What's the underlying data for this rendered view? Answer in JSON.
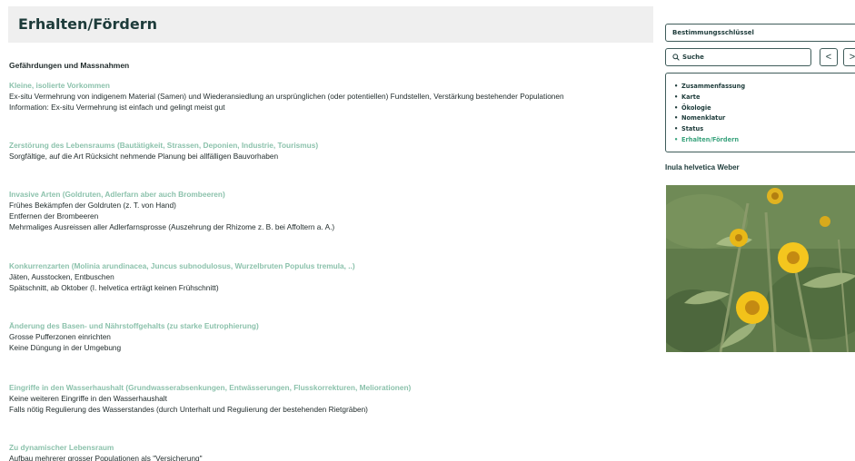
{
  "header": {
    "title": "Erhalten/Fördern"
  },
  "section_title": "Gefährdungen und Massnahmen",
  "sections": [
    {
      "threat": "Kleine, isolierte Vorkommen",
      "measures": [
        "Ex-situ Vermehrung von indigenem Material (Samen) und Wiederansiedlung an ursprünglichen (oder potentiellen) Fundstellen, Verstärkung bestehender Populationen",
        "Information: Ex-situ Vermehrung ist einfach und gelingt meist gut"
      ]
    },
    {
      "threat": "Zerstörung des Lebensraums (Bautätigkeit, Strassen, Deponien, Industrie, Tourismus)",
      "measures": [
        "Sorgfältige, auf die Art Rücksicht nehmende Planung bei allfälligen Bauvorhaben"
      ]
    },
    {
      "threat": "Invasive Arten (Goldruten, Adlerfarn aber auch Brombeeren)",
      "measures": [
        "Frühes Bekämpfen der Goldruten (z. T. von Hand)",
        "Entfernen der Brombeeren",
        "Mehrmaliges Ausreissen aller Adlerfarnsprosse (Auszehrung der Rhizome z. B. bei Affoltern a. A.)"
      ]
    },
    {
      "threat": "Konkurrenzarten (Molinia arundinacea, Juncus subnodulosus, Wurzelbruten Populus tremula, ..)",
      "measures": [
        "Jäten, Ausstocken, Entbuschen",
        "Spätschnitt, ab Oktober (I. helvetica erträgt keinen Frühschnitt)"
      ]
    },
    {
      "threat": "Änderung des Basen- und Nährstoffgehalts (zu starke Eutrophierung)",
      "measures": [
        "Grosse Pufferzonen einrichten",
        "Keine Düngung in der Umgebung"
      ]
    },
    {
      "threat": "Eingriffe in den Wasserhaushalt (Grundwasserabsenkungen, Entwässerungen, Flusskorrekturen, Meliorationen)",
      "measures": [
        "Keine weiteren Eingriffe in den Wasserhaushalt",
        "Falls nötig Regulierung des Wasserstandes (durch Unterhalt und Regulierung der bestehenden Rietgräben)"
      ]
    },
    {
      "threat": "Zu dynamischer Lebensraum",
      "measures": [
        "Aufbau mehrerer grosser Populationen als \"Versicherung\""
      ]
    }
  ],
  "sidebar": {
    "key_label": "Bestimmungsschlüssel",
    "search_label": "Suche",
    "search_icon": "search-icon",
    "prev_glyph": "<",
    "next_glyph": ">",
    "toc": [
      {
        "label": "Zusammenfassung"
      },
      {
        "label": "Karte"
      },
      {
        "label": "Ökologie"
      },
      {
        "label": "Nomenklatur"
      },
      {
        "label": "Status"
      },
      {
        "label": "Erhalten/Fördern"
      }
    ],
    "toc_active": "Erhalten/Fördern",
    "bullet": "•",
    "species_name": "Inula helvetica Weber"
  },
  "colors": {
    "accent": "#3aa37d",
    "threat": "#8cc2ac",
    "title_bg": "#efefef",
    "heading": "#1d3b3a"
  }
}
